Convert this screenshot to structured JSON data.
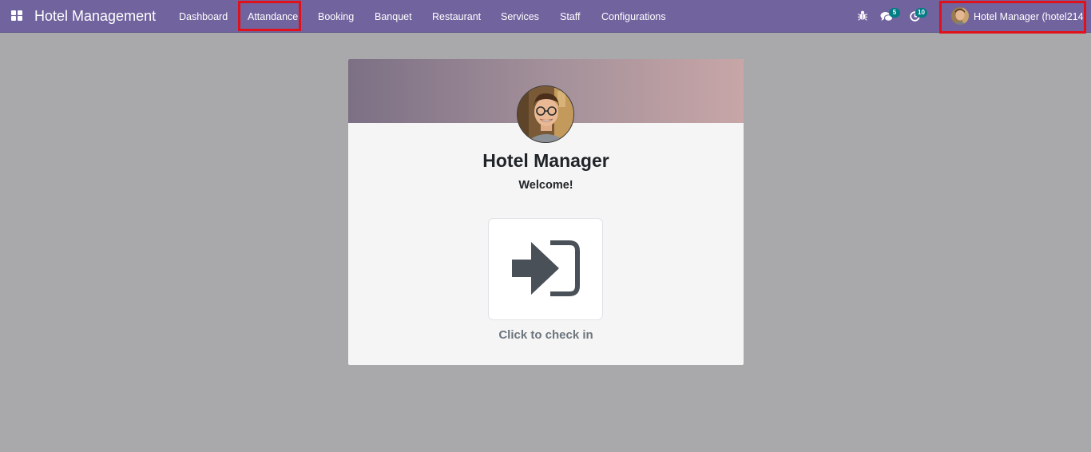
{
  "navbar": {
    "brand": "Hotel Management",
    "menu": [
      {
        "label": "Dashboard"
      },
      {
        "label": "Attandance"
      },
      {
        "label": "Booking"
      },
      {
        "label": "Banquet"
      },
      {
        "label": "Restaurant"
      },
      {
        "label": "Services"
      },
      {
        "label": "Staff"
      },
      {
        "label": "Configurations"
      }
    ],
    "icons": {
      "apps": "apps-grid-icon",
      "debug": "bug-icon",
      "messages": "chat-icon",
      "activities": "clock-icon"
    },
    "messages_count": "5",
    "activities_count": "10",
    "user_label": "Hotel Manager (hotel214)"
  },
  "attendance_card": {
    "employee_name": "Hotel Manager",
    "greeting": "Welcome!",
    "action_label": "Click to check in",
    "action_icon": "sign-in-icon"
  },
  "colors": {
    "navbar": "#71639e",
    "page_background": "#a9a9ab",
    "badge": "#017e84",
    "highlight": "#e01119",
    "icon_dark": "#495057"
  }
}
